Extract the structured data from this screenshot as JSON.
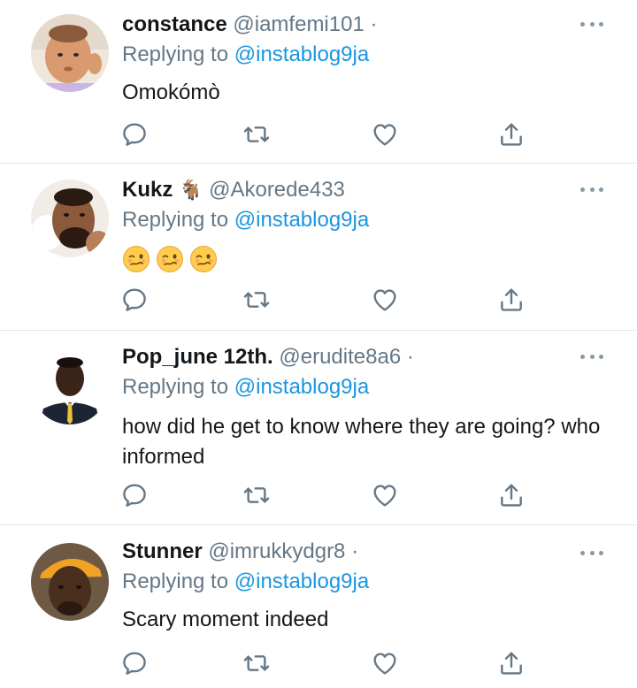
{
  "tweets": [
    {
      "name": "constance",
      "handle": "@iamfemi101",
      "handle_suffix": "·",
      "replying_prefix": "Replying to",
      "replying_to": "@instablog9ja",
      "text": "Omokómò"
    },
    {
      "name": "Kukz",
      "name_emoji": "🐐",
      "handle": "@Akorede433",
      "replying_prefix": "Replying to",
      "replying_to": "@instablog9ja",
      "emoji_row": [
        "woozy-face-emoji",
        "woozy-face-emoji",
        "woozy-face-emoji"
      ]
    },
    {
      "name": "Pop_june 12th.",
      "handle": "@erudite8a6",
      "handle_suffix": "·",
      "replying_prefix": "Replying to",
      "replying_to": "@instablog9ja",
      "text": "how did he get to know where they are going? who informed"
    },
    {
      "name": "Stunner",
      "handle": "@imrukkydgr8",
      "handle_suffix": "·",
      "replying_prefix": "Replying to",
      "replying_to": "@instablog9ja",
      "text": "Scary moment indeed"
    }
  ],
  "icons": {
    "more": "more-dots-icon",
    "reply": "reply-bubble-icon",
    "retweet": "retweet-icon",
    "like": "heart-icon",
    "share": "share-icon"
  },
  "colors": {
    "mention": "#1b95e0",
    "muted": "#657786",
    "icon": "#657786",
    "divider": "#e1e8ed"
  }
}
